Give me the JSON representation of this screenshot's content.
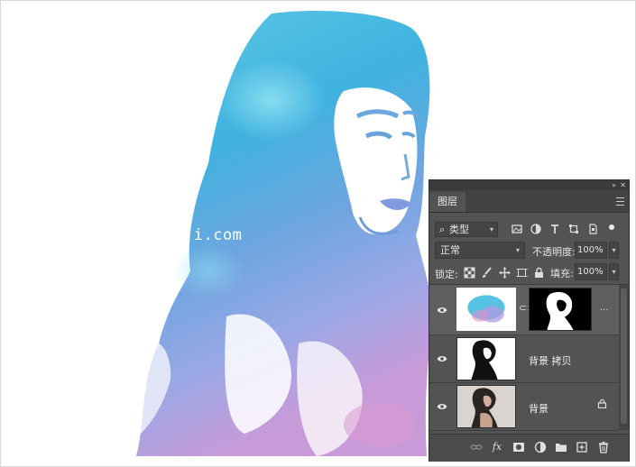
{
  "watermark": "ji.com",
  "panel": {
    "tab": "图层",
    "collapse_glyph": "»",
    "close_glyph": "✕",
    "filter": {
      "search_glyph": "⌕",
      "label": "类型",
      "dropdown_glyph": "▾",
      "icons": [
        "image-filter-icon",
        "adjustment-filter-icon",
        "type-filter-icon",
        "shape-filter-icon",
        "smart-object-filter-icon"
      ]
    },
    "blend_mode": "正常",
    "opacity_label": "不透明度:",
    "opacity": "100%",
    "lock_label": "锁定:",
    "lock_icons": [
      "lock-transparent-pixels-icon",
      "lock-image-pixels-icon",
      "lock-position-icon",
      "prevent-auto-nesting-icon",
      "lock-all-icon"
    ],
    "fill_label": "填充:",
    "fill": "100%",
    "layers": [
      {
        "name": "",
        "selected": true,
        "has_mask": true
      },
      {
        "name": "背景 拷贝",
        "selected": false
      },
      {
        "name": "背景",
        "selected": false,
        "locked": true
      }
    ],
    "bottom_icons": [
      "link-layers-icon",
      "fx-icon",
      "add-mask-icon",
      "adjustment-layer-icon",
      "group-folder-icon",
      "new-layer-icon",
      "delete-icon"
    ],
    "fx_label": "fx",
    "more_glyph": "..."
  }
}
